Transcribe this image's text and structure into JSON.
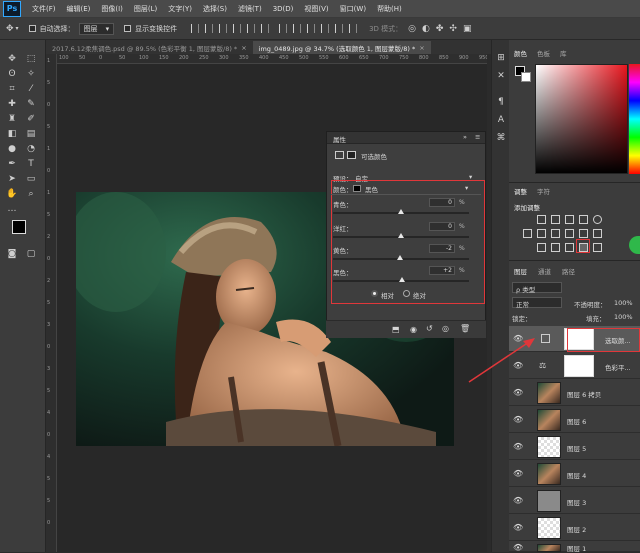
{
  "menu": {
    "logo": "Ps",
    "items": [
      "文件(F)",
      "编辑(E)",
      "图像(I)",
      "图层(L)",
      "文字(Y)",
      "选择(S)",
      "滤镜(T)",
      "3D(D)",
      "视图(V)",
      "窗口(W)",
      "帮助(H)"
    ]
  },
  "options": {
    "auto_select_label": "自动选择：",
    "auto_select_value": "图层",
    "transform_label": "显示变换控件",
    "mode_3d_label": "3D 模式："
  },
  "tabs": [
    {
      "label": "2017.6.12柔焦调色.psd @ 89.5% (色彩平衡 1, 图层蒙版/8) *",
      "close": "×",
      "active": false
    },
    {
      "label": "img_0489.jpg @ 34.7% (选取颜色 1, 图层蒙版/8) *",
      "close": "×",
      "active": true
    }
  ],
  "ruler": {
    "h_labels": [
      "100",
      "50",
      "0",
      "50",
      "100",
      "150",
      "200",
      "250",
      "300",
      "350",
      "400",
      "450",
      "500",
      "550",
      "600",
      "650",
      "700",
      "750",
      "800",
      "850",
      "900",
      "950"
    ],
    "v_labels": [
      "1",
      "5",
      "0",
      "5",
      "1",
      "0",
      "1",
      "5",
      "2",
      "0",
      "2",
      "5",
      "3",
      "0",
      "3",
      "5",
      "4",
      "0",
      "4",
      "5",
      "5",
      "0"
    ]
  },
  "properties": {
    "panel_title": "属性",
    "collapse_icon": "»",
    "adjustment_name": "可选颜色",
    "preset_label": "预设：",
    "preset_value": "自定",
    "colors_label": "颜色：",
    "colors_value": "黑色",
    "sliders": [
      {
        "label": "青色：",
        "value": "0",
        "unit": "%",
        "level": 0
      },
      {
        "label": "洋红：",
        "value": "0",
        "unit": "%",
        "level": 0
      },
      {
        "label": "黄色：",
        "value": "-2",
        "unit": "%",
        "level": -2
      },
      {
        "label": "黑色：",
        "value": "+2",
        "unit": "%",
        "level": 2
      }
    ],
    "method_relative": "相对",
    "method_absolute": "绝对"
  },
  "right": {
    "color_tab": "颜色",
    "swatches_tab": "色板",
    "library_tab": "库",
    "adjust_tab": "调整",
    "char_tab": "字符",
    "add_adjustment": "添加调整",
    "layers_tab": "图层",
    "channels_tab": "通道",
    "paths_tab": "路径",
    "kind_label": "ρ 类型",
    "blend_mode": "正常",
    "opacity_label": "不透明度：",
    "opacity_value": "100%",
    "lock_label": "锁定：",
    "fill_label": "填充：",
    "fill_value": "100%"
  },
  "layers": [
    {
      "name": "选取颜...",
      "selected": true,
      "thumb": "mask-white"
    },
    {
      "name": "色彩平...",
      "selected": false,
      "thumb": "mask-white"
    },
    {
      "name": "图层 6 拷贝",
      "selected": false,
      "thumb": "photo"
    },
    {
      "name": "图层 6",
      "selected": false,
      "thumb": "photo"
    },
    {
      "name": "图层 5",
      "selected": false,
      "thumb": "transparent"
    },
    {
      "name": "图层 4",
      "selected": false,
      "thumb": "photo"
    },
    {
      "name": "图层 3",
      "selected": false,
      "thumb": "gray"
    },
    {
      "name": "图层 2",
      "selected": false,
      "thumb": "transparent"
    },
    {
      "name": "图层 1",
      "selected": false,
      "thumb": "photo"
    }
  ],
  "colors": {
    "accent_red": "#e0373a",
    "panel_bg": "#3c3c3c",
    "canvas_bg": "#282828"
  }
}
